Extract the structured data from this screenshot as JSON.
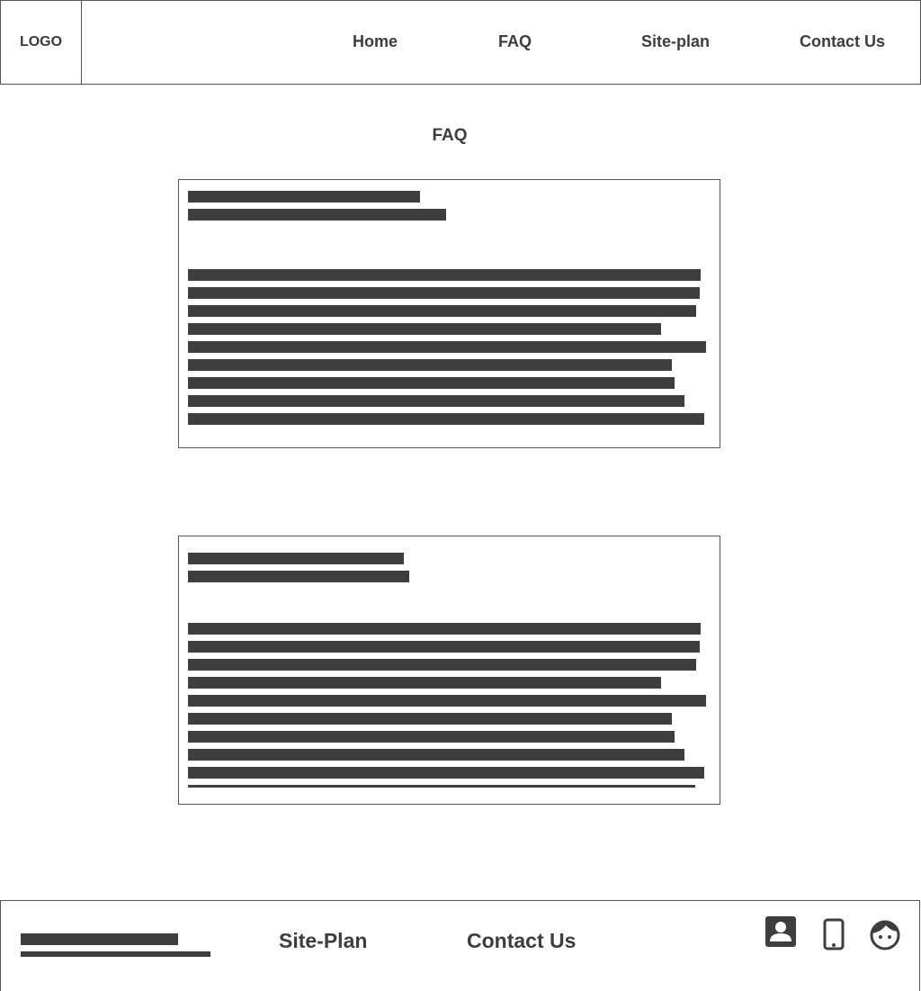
{
  "header": {
    "logo": "LOGO",
    "nav": [
      {
        "label": "Home"
      },
      {
        "label": "FAQ"
      },
      {
        "label": "Site-plan"
      },
      {
        "label": "Contact Us"
      }
    ]
  },
  "main": {
    "title": "FAQ"
  },
  "footer": {
    "links": [
      {
        "label": "Site-Plan"
      },
      {
        "label": "Contact Us"
      }
    ],
    "icons": [
      "contact-card-icon",
      "mobile-phone-icon",
      "face-icon"
    ]
  },
  "colors": {
    "text": "#3d3d3d",
    "placeholder_bar": "#3e3e3e",
    "border": "#555555",
    "background": "#ffffff"
  }
}
